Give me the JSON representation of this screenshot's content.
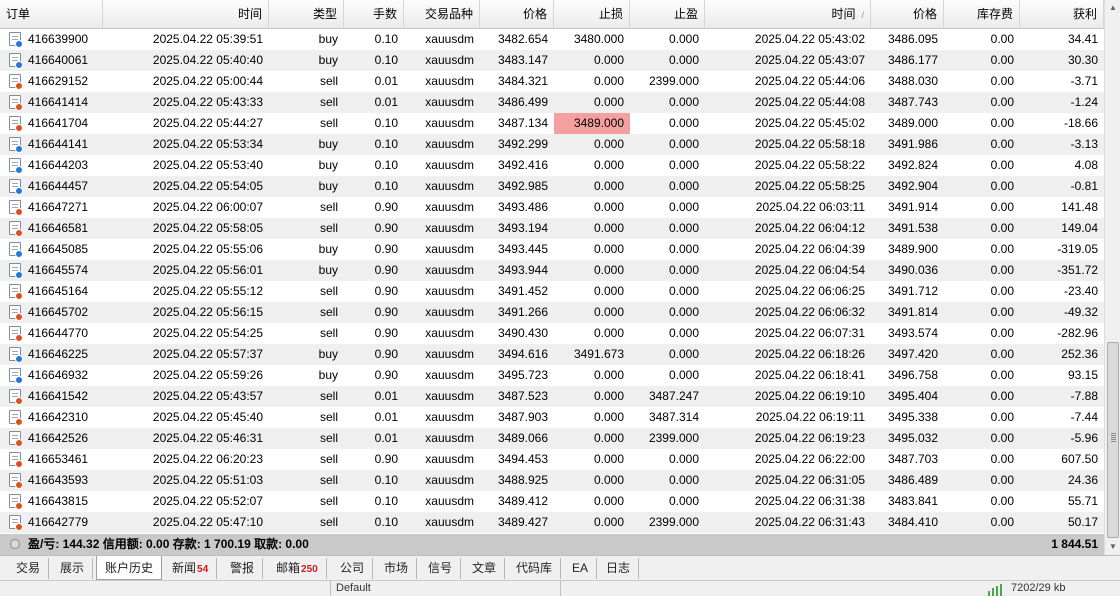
{
  "columns": [
    {
      "key": "order",
      "label": "订单",
      "align": "l"
    },
    {
      "key": "open_time",
      "label": "时间",
      "align": "r"
    },
    {
      "key": "type",
      "label": "类型",
      "align": "r"
    },
    {
      "key": "lots",
      "label": "手数",
      "align": "r"
    },
    {
      "key": "symbol",
      "label": "交易品种",
      "align": "r"
    },
    {
      "key": "open_price",
      "label": "价格",
      "align": "r"
    },
    {
      "key": "sl",
      "label": "止损",
      "align": "r"
    },
    {
      "key": "tp",
      "label": "止盈",
      "align": "r"
    },
    {
      "key": "close_time",
      "label": "时间",
      "align": "r",
      "sort": "/"
    },
    {
      "key": "close_price",
      "label": "价格",
      "align": "r"
    },
    {
      "key": "swap",
      "label": "库存费",
      "align": "r"
    },
    {
      "key": "profit",
      "label": "获利",
      "align": "r"
    }
  ],
  "rows": [
    {
      "order": "416639900",
      "open_time": "2025.04.22 05:39:51",
      "type": "buy",
      "lots": "0.10",
      "symbol": "xauusdm",
      "open_price": "3482.654",
      "sl": "3480.000",
      "tp": "0.000",
      "close_time": "2025.04.22 05:43:02",
      "close_price": "3486.095",
      "swap": "0.00",
      "profit": "34.41"
    },
    {
      "order": "416640061",
      "open_time": "2025.04.22 05:40:40",
      "type": "buy",
      "lots": "0.10",
      "symbol": "xauusdm",
      "open_price": "3483.147",
      "sl": "0.000",
      "tp": "0.000",
      "close_time": "2025.04.22 05:43:07",
      "close_price": "3486.177",
      "swap": "0.00",
      "profit": "30.30"
    },
    {
      "order": "416629152",
      "open_time": "2025.04.22 05:00:44",
      "type": "sell",
      "lots": "0.01",
      "symbol": "xauusdm",
      "open_price": "3484.321",
      "sl": "0.000",
      "tp": "2399.000",
      "close_time": "2025.04.22 05:44:06",
      "close_price": "3488.030",
      "swap": "0.00",
      "profit": "-3.71"
    },
    {
      "order": "416641414",
      "open_time": "2025.04.22 05:43:33",
      "type": "sell",
      "lots": "0.01",
      "symbol": "xauusdm",
      "open_price": "3486.499",
      "sl": "0.000",
      "tp": "0.000",
      "close_time": "2025.04.22 05:44:08",
      "close_price": "3487.743",
      "swap": "0.00",
      "profit": "-1.24"
    },
    {
      "order": "416641704",
      "open_time": "2025.04.22 05:44:27",
      "type": "sell",
      "lots": "0.10",
      "symbol": "xauusdm",
      "open_price": "3487.134",
      "sl": "3489.000",
      "tp": "0.000",
      "close_time": "2025.04.22 05:45:02",
      "close_price": "3489.000",
      "swap": "0.00",
      "profit": "-18.66",
      "sl_hit": true
    },
    {
      "order": "416644141",
      "open_time": "2025.04.22 05:53:34",
      "type": "buy",
      "lots": "0.10",
      "symbol": "xauusdm",
      "open_price": "3492.299",
      "sl": "0.000",
      "tp": "0.000",
      "close_time": "2025.04.22 05:58:18",
      "close_price": "3491.986",
      "swap": "0.00",
      "profit": "-3.13"
    },
    {
      "order": "416644203",
      "open_time": "2025.04.22 05:53:40",
      "type": "buy",
      "lots": "0.10",
      "symbol": "xauusdm",
      "open_price": "3492.416",
      "sl": "0.000",
      "tp": "0.000",
      "close_time": "2025.04.22 05:58:22",
      "close_price": "3492.824",
      "swap": "0.00",
      "profit": "4.08"
    },
    {
      "order": "416644457",
      "open_time": "2025.04.22 05:54:05",
      "type": "buy",
      "lots": "0.10",
      "symbol": "xauusdm",
      "open_price": "3492.985",
      "sl": "0.000",
      "tp": "0.000",
      "close_time": "2025.04.22 05:58:25",
      "close_price": "3492.904",
      "swap": "0.00",
      "profit": "-0.81"
    },
    {
      "order": "416647271",
      "open_time": "2025.04.22 06:00:07",
      "type": "sell",
      "lots": "0.90",
      "symbol": "xauusdm",
      "open_price": "3493.486",
      "sl": "0.000",
      "tp": "0.000",
      "close_time": "2025.04.22 06:03:11",
      "close_price": "3491.914",
      "swap": "0.00",
      "profit": "141.48"
    },
    {
      "order": "416646581",
      "open_time": "2025.04.22 05:58:05",
      "type": "sell",
      "lots": "0.90",
      "symbol": "xauusdm",
      "open_price": "3493.194",
      "sl": "0.000",
      "tp": "0.000",
      "close_time": "2025.04.22 06:04:12",
      "close_price": "3491.538",
      "swap": "0.00",
      "profit": "149.04"
    },
    {
      "order": "416645085",
      "open_time": "2025.04.22 05:55:06",
      "type": "buy",
      "lots": "0.90",
      "symbol": "xauusdm",
      "open_price": "3493.445",
      "sl": "0.000",
      "tp": "0.000",
      "close_time": "2025.04.22 06:04:39",
      "close_price": "3489.900",
      "swap": "0.00",
      "profit": "-319.05"
    },
    {
      "order": "416645574",
      "open_time": "2025.04.22 05:56:01",
      "type": "buy",
      "lots": "0.90",
      "symbol": "xauusdm",
      "open_price": "3493.944",
      "sl": "0.000",
      "tp": "0.000",
      "close_time": "2025.04.22 06:04:54",
      "close_price": "3490.036",
      "swap": "0.00",
      "profit": "-351.72"
    },
    {
      "order": "416645164",
      "open_time": "2025.04.22 05:55:12",
      "type": "sell",
      "lots": "0.90",
      "symbol": "xauusdm",
      "open_price": "3491.452",
      "sl": "0.000",
      "tp": "0.000",
      "close_time": "2025.04.22 06:06:25",
      "close_price": "3491.712",
      "swap": "0.00",
      "profit": "-23.40"
    },
    {
      "order": "416645702",
      "open_time": "2025.04.22 05:56:15",
      "type": "sell",
      "lots": "0.90",
      "symbol": "xauusdm",
      "open_price": "3491.266",
      "sl": "0.000",
      "tp": "0.000",
      "close_time": "2025.04.22 06:06:32",
      "close_price": "3491.814",
      "swap": "0.00",
      "profit": "-49.32"
    },
    {
      "order": "416644770",
      "open_time": "2025.04.22 05:54:25",
      "type": "sell",
      "lots": "0.90",
      "symbol": "xauusdm",
      "open_price": "3490.430",
      "sl": "0.000",
      "tp": "0.000",
      "close_time": "2025.04.22 06:07:31",
      "close_price": "3493.574",
      "swap": "0.00",
      "profit": "-282.96"
    },
    {
      "order": "416646225",
      "open_time": "2025.04.22 05:57:37",
      "type": "buy",
      "lots": "0.90",
      "symbol": "xauusdm",
      "open_price": "3494.616",
      "sl": "3491.673",
      "tp": "0.000",
      "close_time": "2025.04.22 06:18:26",
      "close_price": "3497.420",
      "swap": "0.00",
      "profit": "252.36"
    },
    {
      "order": "416646932",
      "open_time": "2025.04.22 05:59:26",
      "type": "buy",
      "lots": "0.90",
      "symbol": "xauusdm",
      "open_price": "3495.723",
      "sl": "0.000",
      "tp": "0.000",
      "close_time": "2025.04.22 06:18:41",
      "close_price": "3496.758",
      "swap": "0.00",
      "profit": "93.15"
    },
    {
      "order": "416641542",
      "open_time": "2025.04.22 05:43:57",
      "type": "sell",
      "lots": "0.01",
      "symbol": "xauusdm",
      "open_price": "3487.523",
      "sl": "0.000",
      "tp": "3487.247",
      "close_time": "2025.04.22 06:19:10",
      "close_price": "3495.404",
      "swap": "0.00",
      "profit": "-7.88"
    },
    {
      "order": "416642310",
      "open_time": "2025.04.22 05:45:40",
      "type": "sell",
      "lots": "0.01",
      "symbol": "xauusdm",
      "open_price": "3487.903",
      "sl": "0.000",
      "tp": "3487.314",
      "close_time": "2025.04.22 06:19:11",
      "close_price": "3495.338",
      "swap": "0.00",
      "profit": "-7.44"
    },
    {
      "order": "416642526",
      "open_time": "2025.04.22 05:46:31",
      "type": "sell",
      "lots": "0.01",
      "symbol": "xauusdm",
      "open_price": "3489.066",
      "sl": "0.000",
      "tp": "2399.000",
      "close_time": "2025.04.22 06:19:23",
      "close_price": "3495.032",
      "swap": "0.00",
      "profit": "-5.96"
    },
    {
      "order": "416653461",
      "open_time": "2025.04.22 06:20:23",
      "type": "sell",
      "lots": "0.90",
      "symbol": "xauusdm",
      "open_price": "3494.453",
      "sl": "0.000",
      "tp": "0.000",
      "close_time": "2025.04.22 06:22:00",
      "close_price": "3487.703",
      "swap": "0.00",
      "profit": "607.50"
    },
    {
      "order": "416643593",
      "open_time": "2025.04.22 05:51:03",
      "type": "sell",
      "lots": "0.10",
      "symbol": "xauusdm",
      "open_price": "3488.925",
      "sl": "0.000",
      "tp": "0.000",
      "close_time": "2025.04.22 06:31:05",
      "close_price": "3486.489",
      "swap": "0.00",
      "profit": "24.36"
    },
    {
      "order": "416643815",
      "open_time": "2025.04.22 05:52:07",
      "type": "sell",
      "lots": "0.10",
      "symbol": "xauusdm",
      "open_price": "3489.412",
      "sl": "0.000",
      "tp": "0.000",
      "close_time": "2025.04.22 06:31:38",
      "close_price": "3483.841",
      "swap": "0.00",
      "profit": "55.71"
    },
    {
      "order": "416642779",
      "open_time": "2025.04.22 05:47:10",
      "type": "sell",
      "lots": "0.10",
      "symbol": "xauusdm",
      "open_price": "3489.427",
      "sl": "0.000",
      "tp": "2399.000",
      "close_time": "2025.04.22 06:31:43",
      "close_price": "3484.410",
      "swap": "0.00",
      "profit": "50.17"
    }
  ],
  "summary": {
    "text": "盈/亏: 144.32  信用额: 0.00  存款: 1 700.19  取款: 0.00",
    "total": "1 844.51"
  },
  "tabs": [
    {
      "label": "交易",
      "badge": ""
    },
    {
      "label": "展示",
      "badge": ""
    },
    {
      "label": "账户历史",
      "badge": "",
      "active": true
    },
    {
      "label": "新闻",
      "badge": "54"
    },
    {
      "label": "警报",
      "badge": ""
    },
    {
      "label": "邮箱",
      "badge": "250"
    },
    {
      "label": "公司",
      "badge": ""
    },
    {
      "label": "市场",
      "badge": ""
    },
    {
      "label": "信号",
      "badge": ""
    },
    {
      "label": "文章",
      "badge": ""
    },
    {
      "label": "代码库",
      "badge": ""
    },
    {
      "label": "EA",
      "badge": ""
    },
    {
      "label": "日志",
      "badge": ""
    }
  ],
  "statusbar": {
    "profile": "Default",
    "connection": "7202/29 kb"
  },
  "colors": {
    "buy_dot": "#1f7ad8",
    "sell_dot": "#e0501c",
    "sl_highlight": "#f5a0a0",
    "summary_bg": "#c9c9c9"
  }
}
